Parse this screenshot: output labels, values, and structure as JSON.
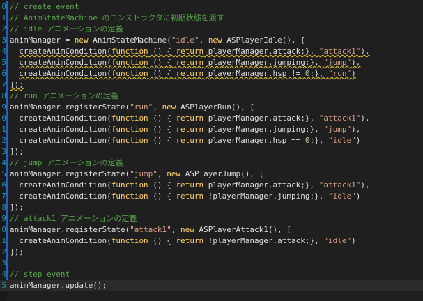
{
  "editor": {
    "line_numbers": [
      "0",
      "1",
      "2",
      "3",
      "4",
      "5",
      "6",
      "7",
      "8",
      "9",
      "0",
      "1",
      "2",
      "3",
      "4",
      "5",
      "6",
      "7",
      "8",
      "9",
      "0",
      "1",
      "2",
      "3",
      "4",
      "5"
    ],
    "lines": [
      [
        {
          "t": "// create event",
          "c": "c"
        }
      ],
      [
        {
          "t": "// AnimStateMachine のコンストラクタに初期状態を渡す",
          "c": "c"
        }
      ],
      [
        {
          "t": "// idle アニメーションの定義",
          "c": "c"
        }
      ],
      [
        {
          "t": "animManager = ",
          "c": "v"
        },
        {
          "t": "new ",
          "c": "k"
        },
        {
          "t": "AnimStateMachine(",
          "c": "v"
        },
        {
          "t": "\"idle\"",
          "c": "s"
        },
        {
          "t": ", ",
          "c": "p"
        },
        {
          "t": "new ",
          "c": "k"
        },
        {
          "t": "ASPlayerIdle(), [",
          "c": "v"
        }
      ],
      [
        {
          "t": "  ",
          "c": "p"
        },
        {
          "t": "createAnimCondition(",
          "c": "v",
          "err": true
        },
        {
          "t": "function",
          "c": "k",
          "err": true
        },
        {
          "t": " () { ",
          "c": "p",
          "err": true
        },
        {
          "t": "return",
          "c": "k",
          "err": true
        },
        {
          "t": " playerManager.attack;}, ",
          "c": "v",
          "err": true
        },
        {
          "t": "\"attack1\"",
          "c": "s",
          "err": true
        },
        {
          "t": "),",
          "c": "p",
          "err": true
        }
      ],
      [
        {
          "t": "  ",
          "c": "p"
        },
        {
          "t": "createAnimCondition(",
          "c": "v",
          "err": true
        },
        {
          "t": "function",
          "c": "k",
          "err": true
        },
        {
          "t": " () { ",
          "c": "p",
          "err": true
        },
        {
          "t": "return",
          "c": "k",
          "err": true
        },
        {
          "t": " playerManager.jumping;}, ",
          "c": "v",
          "err": true
        },
        {
          "t": "\"jump\"",
          "c": "s",
          "err": true
        },
        {
          "t": "),",
          "c": "p",
          "err": true
        }
      ],
      [
        {
          "t": "  ",
          "c": "p"
        },
        {
          "t": "createAnimCondition(",
          "c": "v",
          "err": true
        },
        {
          "t": "function",
          "c": "k",
          "err": true
        },
        {
          "t": " () { ",
          "c": "p",
          "err": true
        },
        {
          "t": "return",
          "c": "k",
          "err": true
        },
        {
          "t": " playerManager.hsp != ",
          "c": "v",
          "err": true
        },
        {
          "t": "0",
          "c": "n",
          "err": true
        },
        {
          "t": ";}, ",
          "c": "p",
          "err": true
        },
        {
          "t": "\"run\"",
          "c": "s",
          "err": true
        },
        {
          "t": ")",
          "c": "p",
          "err": true
        }
      ],
      [
        {
          "t": "]);",
          "c": "p",
          "err": true
        }
      ],
      [
        {
          "t": "// run アニメーションの定義",
          "c": "c"
        }
      ],
      [
        {
          "t": "animManager.registerState(",
          "c": "v"
        },
        {
          "t": "\"run\"",
          "c": "s"
        },
        {
          "t": ", ",
          "c": "p"
        },
        {
          "t": "new ",
          "c": "k"
        },
        {
          "t": "ASPlayerRun(), [",
          "c": "v"
        }
      ],
      [
        {
          "t": "  createAnimCondition(",
          "c": "v"
        },
        {
          "t": "function",
          "c": "k"
        },
        {
          "t": " () { ",
          "c": "p"
        },
        {
          "t": "return",
          "c": "k"
        },
        {
          "t": " playerManager.attack;}, ",
          "c": "v"
        },
        {
          "t": "\"attack1\"",
          "c": "s"
        },
        {
          "t": "),",
          "c": "p"
        }
      ],
      [
        {
          "t": "  createAnimCondition(",
          "c": "v"
        },
        {
          "t": "function",
          "c": "k"
        },
        {
          "t": " () { ",
          "c": "p"
        },
        {
          "t": "return",
          "c": "k"
        },
        {
          "t": " playerManager.jumping;}, ",
          "c": "v"
        },
        {
          "t": "\"jump\"",
          "c": "s"
        },
        {
          "t": "),",
          "c": "p"
        }
      ],
      [
        {
          "t": "  createAnimCondition(",
          "c": "v"
        },
        {
          "t": "function",
          "c": "k"
        },
        {
          "t": " () { ",
          "c": "p"
        },
        {
          "t": "return",
          "c": "k"
        },
        {
          "t": " playerManager.hsp == ",
          "c": "v"
        },
        {
          "t": "0",
          "c": "n"
        },
        {
          "t": ";}, ",
          "c": "p"
        },
        {
          "t": "\"idle\"",
          "c": "s"
        },
        {
          "t": ")",
          "c": "p"
        }
      ],
      [
        {
          "t": "]);",
          "c": "p"
        }
      ],
      [
        {
          "t": "// jump アニメーションの定義",
          "c": "c"
        }
      ],
      [
        {
          "t": "animManager.registerState(",
          "c": "v"
        },
        {
          "t": "\"jump\"",
          "c": "s"
        },
        {
          "t": ", ",
          "c": "p"
        },
        {
          "t": "new ",
          "c": "k"
        },
        {
          "t": "ASPlayerJump(), [",
          "c": "v"
        }
      ],
      [
        {
          "t": "  createAnimCondition(",
          "c": "v"
        },
        {
          "t": "function",
          "c": "k"
        },
        {
          "t": " () { ",
          "c": "p"
        },
        {
          "t": "return",
          "c": "k"
        },
        {
          "t": " playerManager.attack;}, ",
          "c": "v"
        },
        {
          "t": "\"attack1\"",
          "c": "s"
        },
        {
          "t": "),",
          "c": "p"
        }
      ],
      [
        {
          "t": "  createAnimCondition(",
          "c": "v"
        },
        {
          "t": "function",
          "c": "k"
        },
        {
          "t": " () { ",
          "c": "p"
        },
        {
          "t": "return",
          "c": "k"
        },
        {
          "t": " !playerManager.jumping;}, ",
          "c": "v"
        },
        {
          "t": "\"idle\"",
          "c": "s"
        },
        {
          "t": ")",
          "c": "p"
        }
      ],
      [
        {
          "t": "]);",
          "c": "p"
        }
      ],
      [
        {
          "t": "// attack1 アニメーションの定義",
          "c": "c"
        }
      ],
      [
        {
          "t": "animManager.registerState(",
          "c": "v"
        },
        {
          "t": "\"attack1\"",
          "c": "s"
        },
        {
          "t": ", ",
          "c": "p"
        },
        {
          "t": "new ",
          "c": "k"
        },
        {
          "t": "ASPlayerAttack1(), [",
          "c": "v"
        }
      ],
      [
        {
          "t": "  createAnimCondition(",
          "c": "v"
        },
        {
          "t": "function",
          "c": "k"
        },
        {
          "t": " () { ",
          "c": "p"
        },
        {
          "t": "return",
          "c": "k"
        },
        {
          "t": " !playerManager.attack;}, ",
          "c": "v"
        },
        {
          "t": "\"idle\"",
          "c": "s"
        },
        {
          "t": ")",
          "c": "p"
        }
      ],
      [
        {
          "t": "]);",
          "c": "p"
        }
      ],
      [],
      [
        {
          "t": "// step event",
          "c": "c"
        }
      ],
      [
        {
          "t": "animManager.update();",
          "c": "v"
        }
      ]
    ],
    "current_line": 25,
    "colors": {
      "background": "#1f1f1f",
      "comment": "#57a64a",
      "keyword": "#fcd069",
      "string": "#d69d85",
      "number": "#b5cea8",
      "text": "#dcdcdc",
      "line_number": "#2b91af",
      "error_squiggle": "#e0c02a"
    }
  }
}
